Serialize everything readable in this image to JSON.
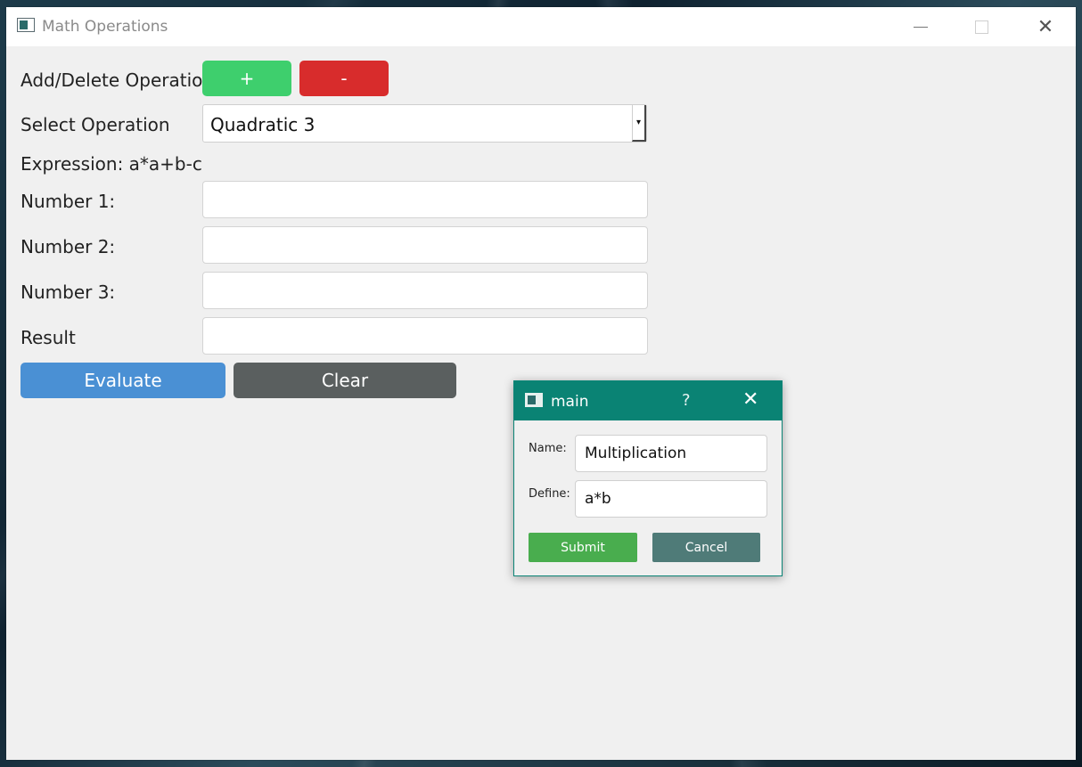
{
  "window": {
    "title": "Math Operations"
  },
  "form": {
    "add_delete_label": "Add/Delete Operation",
    "add_button": "+",
    "delete_button": "-",
    "select_label": "Select Operation",
    "selected_operation": "Quadratic 3",
    "expression_text": "Expression: a*a+b-c",
    "number1_label": "Number 1:",
    "number2_label": "Number 2:",
    "number3_label": "Number 3:",
    "result_label": "Result",
    "number1_value": "",
    "number2_value": "",
    "number3_value": "",
    "result_value": "",
    "evaluate_button": "Evaluate",
    "clear_button": "Clear"
  },
  "dialog": {
    "title": "main",
    "help": "?",
    "name_label": "Name:",
    "name_value": "Multiplication",
    "define_label": "Define:",
    "define_value": "a*b",
    "submit_button": "Submit",
    "cancel_button": "Cancel"
  },
  "colors": {
    "add": "#3ecf6d",
    "delete": "#d82c2c",
    "evaluate": "#4a90d4",
    "clear": "#5a5f5f",
    "dialog_titlebar": "#0a8374",
    "submit": "#49ad4e",
    "cancel": "#4f7b78"
  }
}
